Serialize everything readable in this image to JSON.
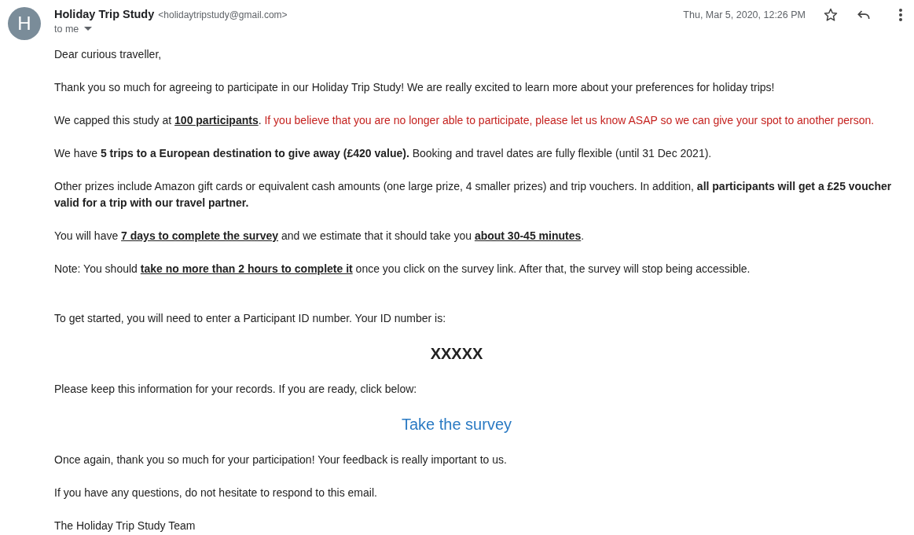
{
  "message": {
    "avatar": "H",
    "sender_name": "Holiday Trip Study",
    "sender_email": "<holidaytripstudy@gmail.com>",
    "recipient": "to me",
    "date": "Thu, Mar 5, 2020, 12:26 PM",
    "starred": false
  },
  "body": [
    {
      "kind": "paragraph",
      "segments": [
        {
          "text": "Dear curious traveller,",
          "kind": "plain"
        }
      ]
    },
    {
      "kind": "paragraph",
      "segments": [
        {
          "text": "Thank you so much for agreeing to participate in our Holiday Trip Study! We are really excited to learn more about your preferences for holiday trips!",
          "kind": "plain"
        }
      ]
    },
    {
      "kind": "paragraph",
      "segments": [
        {
          "text": "We capped this study at ",
          "kind": "plain"
        },
        {
          "text": "100 participants",
          "kind": "underlined"
        },
        {
          "text": ". ",
          "kind": "plain"
        },
        {
          "text": "If you believe that you are no longer able to participate, please let us know ASAP so we can give your spot to another person.",
          "kind": "warning"
        }
      ]
    },
    {
      "kind": "paragraph",
      "segments": [
        {
          "text": "We have ",
          "kind": "plain"
        },
        {
          "text": "5 trips to a European destination to give away (£420 value).",
          "kind": "bold"
        },
        {
          "text": " Booking and travel dates are fully flexible (until 31 Dec 2021).",
          "kind": "plain"
        }
      ]
    },
    {
      "kind": "paragraph",
      "segments": [
        {
          "text": "Other prizes include Amazon gift cards or equivalent cash amounts (one large prize, 4 smaller prizes) and trip vouchers.  In addition, ",
          "kind": "plain"
        },
        {
          "text": "all participants will get a £25 voucher valid for a trip with our travel partner.",
          "kind": "bold"
        }
      ]
    },
    {
      "kind": "paragraph",
      "segments": [
        {
          "text": "You will have ",
          "kind": "plain"
        },
        {
          "text": "7 days to complete the survey",
          "kind": "underlined"
        },
        {
          "text": " and we estimate that it should take you ",
          "kind": "plain"
        },
        {
          "text": "about 30-45 minutes",
          "kind": "underlined"
        },
        {
          "text": ".",
          "kind": "plain"
        }
      ]
    },
    {
      "kind": "paragraph",
      "segments": [
        {
          "text": "Note: You should ",
          "kind": "plain"
        },
        {
          "text": "take no more than 2 hours to complete it",
          "kind": "underlined"
        },
        {
          "text": " once you click on the survey link. After that, the survey will stop being accessible.",
          "kind": "plain"
        }
      ]
    },
    {
      "kind": "spacer"
    },
    {
      "kind": "paragraph",
      "segments": [
        {
          "text": "To get started, you will need to enter a Participant ID number. Your ID number is:",
          "kind": "plain"
        }
      ]
    },
    {
      "kind": "id",
      "text": "XXXXX"
    },
    {
      "kind": "paragraph",
      "segments": [
        {
          "text": "Please keep this information for your records. If you are ready, click below:",
          "kind": "plain"
        }
      ]
    },
    {
      "kind": "link",
      "text": "Take the survey"
    },
    {
      "kind": "paragraph",
      "segments": [
        {
          "text": "Once again, thank you so much for your participation! Your feedback is really important to us.",
          "kind": "plain"
        }
      ]
    },
    {
      "kind": "paragraph",
      "segments": [
        {
          "text": "If you have any questions, do not hesitate to respond to this email.",
          "kind": "plain"
        }
      ]
    },
    {
      "kind": "paragraph",
      "segments": [
        {
          "text": "The Holiday Trip Study Team",
          "kind": "plain"
        }
      ]
    }
  ]
}
